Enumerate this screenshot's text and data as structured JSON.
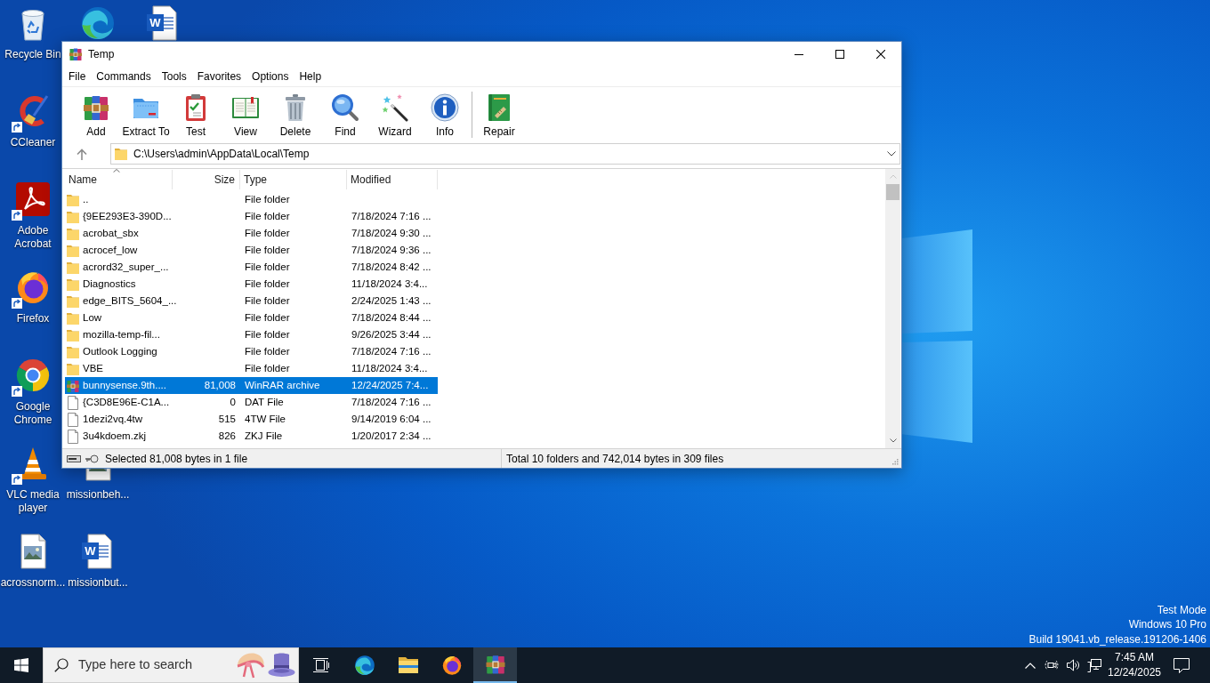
{
  "desktop": {
    "icons": [
      {
        "kind": "recycle-bin",
        "label": "Recycle Bin",
        "shortcut": false
      },
      {
        "kind": "edge",
        "shortcut": false
      },
      {
        "kind": "word-document",
        "badge": "W",
        "shortcut": false
      },
      {
        "kind": "ccleaner",
        "label": "CCleaner",
        "shortcut": true
      },
      {
        "kind": "acrobat",
        "label": "Adobe Acrobat",
        "shortcut": true
      },
      {
        "kind": "firefox",
        "label": "Firefox",
        "shortcut": true
      },
      {
        "kind": "chrome",
        "label": "Google Chrome",
        "shortcut": true
      },
      {
        "kind": "vlc",
        "label": "VLC media player",
        "shortcut": true
      },
      {
        "kind": "image-file",
        "label": "missionbeh...",
        "shortcut": false
      },
      {
        "kind": "image-file",
        "label": "acrossnorm...",
        "shortcut": false
      },
      {
        "kind": "word-document",
        "badge": "W",
        "label": "missionbut...",
        "shortcut": false
      }
    ],
    "system_notice": [
      "Test Mode",
      "Windows 10 Pro",
      "Build 19041.vb_release.191206-1406"
    ]
  },
  "window": {
    "title": "Temp",
    "menu": [
      "File",
      "Commands",
      "Tools",
      "Favorites",
      "Options",
      "Help"
    ],
    "toolbar_groups": [
      [
        {
          "kind": "add",
          "label": "Add"
        },
        {
          "kind": "extract",
          "label": "Extract To"
        },
        {
          "kind": "test",
          "label": "Test"
        },
        {
          "kind": "view",
          "label": "View"
        },
        {
          "kind": "delete",
          "label": "Delete"
        },
        {
          "kind": "find",
          "label": "Find"
        },
        {
          "kind": "wizard",
          "label": "Wizard"
        },
        {
          "kind": "info",
          "label": "Info"
        }
      ],
      [
        {
          "kind": "repair",
          "label": "Repair"
        }
      ]
    ],
    "address": "C:\\Users\\admin\\AppData\\Local\\Temp",
    "columns": [
      {
        "label": "Name",
        "sorted": true
      },
      {
        "label": "Size",
        "sorted": false
      },
      {
        "label": "Type",
        "sorted": false
      },
      {
        "label": "Modified",
        "sorted": false
      }
    ],
    "rows": [
      {
        "kind": "folder",
        "name": "..",
        "type": "File folder",
        "selected": false
      },
      {
        "kind": "folder",
        "name": "{9EE293E3-390D...",
        "type": "File folder",
        "modified": "7/18/2024 7:16 ...",
        "selected": false
      },
      {
        "kind": "folder",
        "name": "acrobat_sbx",
        "type": "File folder",
        "modified": "7/18/2024 9:30 ...",
        "selected": false
      },
      {
        "kind": "folder",
        "name": "acrocef_low",
        "type": "File folder",
        "modified": "7/18/2024 9:36 ...",
        "selected": false
      },
      {
        "kind": "folder",
        "name": "acrord32_super_...",
        "type": "File folder",
        "modified": "7/18/2024 8:42 ...",
        "selected": false
      },
      {
        "kind": "folder",
        "name": "Diagnostics",
        "type": "File folder",
        "modified": "11/18/2024 3:4...",
        "selected": false
      },
      {
        "kind": "folder",
        "name": "edge_BITS_5604_...",
        "type": "File folder",
        "modified": "2/24/2025 1:43 ...",
        "selected": false
      },
      {
        "kind": "folder",
        "name": "Low",
        "type": "File folder",
        "modified": "7/18/2024 8:44 ...",
        "selected": false
      },
      {
        "kind": "folder",
        "name": "mozilla-temp-fil...",
        "type": "File folder",
        "modified": "9/26/2025 3:44 ...",
        "selected": false
      },
      {
        "kind": "folder",
        "name": "Outlook Logging",
        "type": "File folder",
        "modified": "7/18/2024 7:16 ...",
        "selected": false
      },
      {
        "kind": "folder",
        "name": "VBE",
        "type": "File folder",
        "modified": "11/18/2024 3:4...",
        "selected": false
      },
      {
        "kind": "archive",
        "name": "bunnysense.9th....",
        "size": "81,008",
        "type": "WinRAR archive",
        "modified": "12/24/2025 7:4...",
        "selected": true
      },
      {
        "kind": "file",
        "name": "{C3D8E96E-C1A...",
        "size": "0",
        "type": "DAT File",
        "modified": "7/18/2024 7:16 ...",
        "selected": false
      },
      {
        "kind": "file",
        "name": "1dezi2vq.4tw",
        "size": "515",
        "type": "4TW File",
        "modified": "9/14/2019 6:04 ...",
        "selected": false
      },
      {
        "kind": "file",
        "name": "3u4kdoem.zkj",
        "size": "826",
        "type": "ZKJ File",
        "modified": "1/20/2017 2:34 ...",
        "selected": false
      }
    ],
    "status": {
      "selection": "Selected 81,008 bytes in 1 file",
      "total": "Total 10 folders and 742,014 bytes in 309 files"
    }
  },
  "taskbar": {
    "search_placeholder": "Type here to search",
    "apps": [
      {
        "kind": "task-view",
        "active": false
      },
      {
        "kind": "edge",
        "active": false
      },
      {
        "kind": "explorer",
        "active": false
      },
      {
        "kind": "firefox",
        "active": false
      },
      {
        "kind": "winrar",
        "active": true
      }
    ],
    "tray": [
      {
        "kind": "chevron"
      },
      {
        "kind": "meet"
      },
      {
        "kind": "speaker"
      },
      {
        "kind": "network"
      }
    ],
    "clock": {
      "time": "7:45 AM",
      "date": "12/24/2025"
    }
  }
}
